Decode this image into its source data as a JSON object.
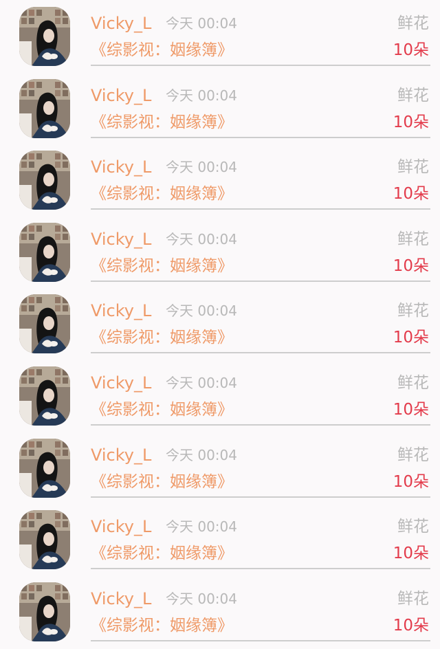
{
  "records": [
    {
      "name": "Vicky_L",
      "time": "今天 00:04",
      "gift_type": "鲜花",
      "work_title": "《综影视：姻缘簿》",
      "gift_count": "10朵"
    },
    {
      "name": "Vicky_L",
      "time": "今天 00:04",
      "gift_type": "鲜花",
      "work_title": "《综影视：姻缘簿》",
      "gift_count": "10朵"
    },
    {
      "name": "Vicky_L",
      "time": "今天 00:04",
      "gift_type": "鲜花",
      "work_title": "《综影视：姻缘簿》",
      "gift_count": "10朵"
    },
    {
      "name": "Vicky_L",
      "time": "今天 00:04",
      "gift_type": "鲜花",
      "work_title": "《综影视：姻缘簿》",
      "gift_count": "10朵"
    },
    {
      "name": "Vicky_L",
      "time": "今天 00:04",
      "gift_type": "鲜花",
      "work_title": "《综影视：姻缘簿》",
      "gift_count": "10朵"
    },
    {
      "name": "Vicky_L",
      "time": "今天 00:04",
      "gift_type": "鲜花",
      "work_title": "《综影视：姻缘簿》",
      "gift_count": "10朵"
    },
    {
      "name": "Vicky_L",
      "time": "今天 00:04",
      "gift_type": "鲜花",
      "work_title": "《综影视：姻缘簿》",
      "gift_count": "10朵"
    },
    {
      "name": "Vicky_L",
      "time": "今天 00:04",
      "gift_type": "鲜花",
      "work_title": "《综影视：姻缘簿》",
      "gift_count": "10朵"
    },
    {
      "name": "Vicky_L",
      "time": "今天 00:04",
      "gift_type": "鲜花",
      "work_title": "《综影视：姻缘簿》",
      "gift_count": "10朵"
    }
  ],
  "colors": {
    "background": "#fbf9fa",
    "name": "#ef9a68",
    "meta": "#b8b8b8",
    "count": "#e33b4b",
    "divider": "#cdcdcd"
  },
  "icons": {
    "avatar": "user-avatar-photo"
  }
}
